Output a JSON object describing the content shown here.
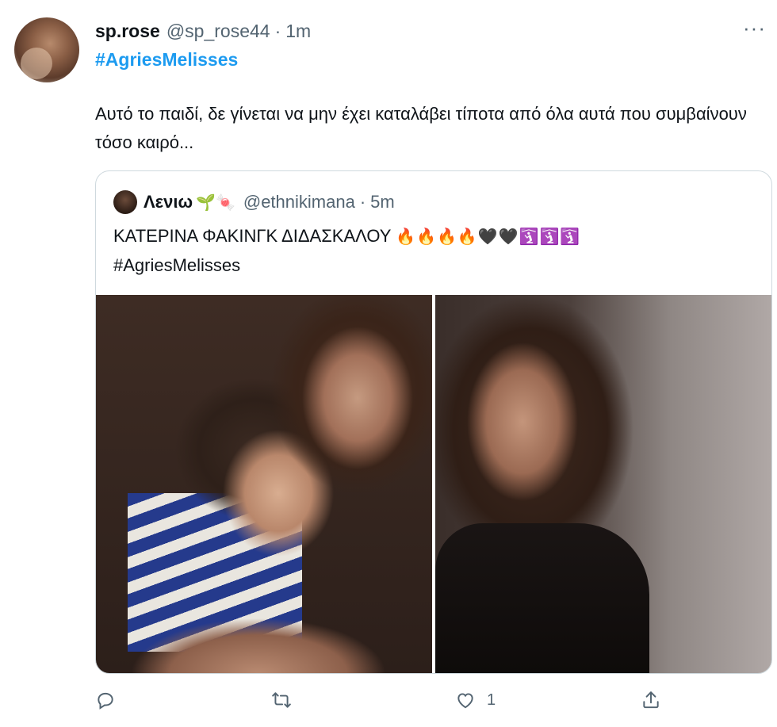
{
  "tweet": {
    "display_name": "sp.rose",
    "handle": "@sp_rose44",
    "separator": "·",
    "timestamp": "1m",
    "more_label": "···",
    "hashtag": "#AgriesMelisses",
    "text": "Αυτό το παιδί, δε γίνεται να μην έχει καταλάβει τίποτα από όλα αυτά που συμβαίνουν τόσο καιρό..."
  },
  "quoted_tweet": {
    "display_name": "Λενιω",
    "name_emojis": "🌱🍬",
    "handle": "@ethnikimana",
    "separator": "·",
    "timestamp": "5m",
    "text": "ΚΑΤΕΡΙΝΑ ΦΑΚΙΝΓΚ ΔΙΔΑΣΚΑΛΟΥ",
    "text_emojis": "🔥🔥🔥🔥🖤🖤🛐🛐🛐",
    "hashtag": "#AgriesMelisses",
    "media": [
      "photo-woman-hugging-boy",
      "photo-woman-closeup"
    ]
  },
  "actions": {
    "reply_count": "",
    "retweet_count": "",
    "like_count": "1",
    "share_count": ""
  },
  "colors": {
    "accent": "#1d9bf0",
    "secondary_text": "#536471",
    "border": "#cfd9de"
  }
}
